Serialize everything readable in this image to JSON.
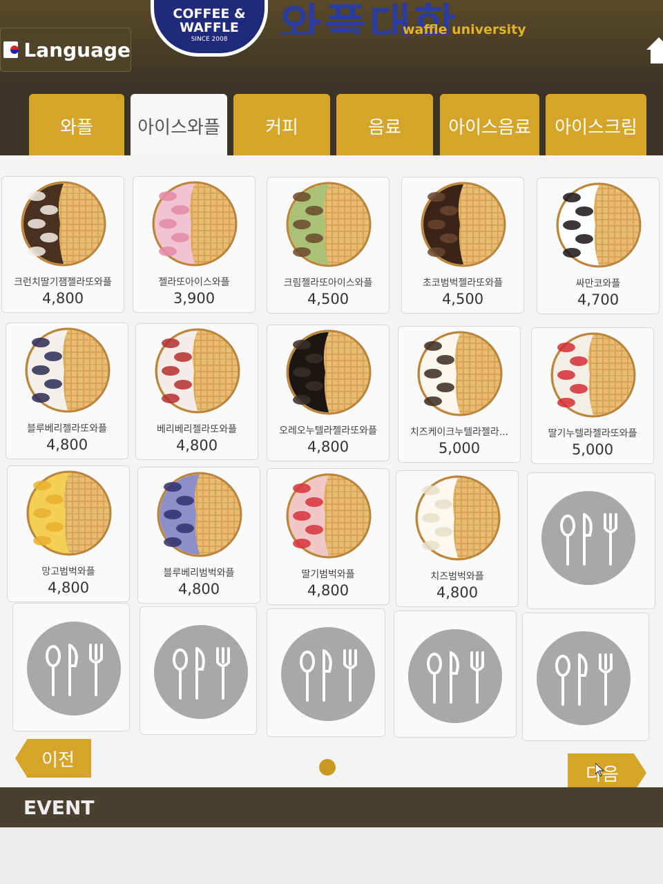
{
  "header": {
    "language_label": "Language",
    "logo_line1": "COFFEE &",
    "logo_line2": "WAFFLE",
    "logo_since": "SINCE 2008",
    "brand_name_kr": "와플대학",
    "brand_name_en": "waffle university"
  },
  "tabs": [
    {
      "label": "와플",
      "active": false
    },
    {
      "label": "아이스와플",
      "active": true
    },
    {
      "label": "커피",
      "active": false
    },
    {
      "label": "음료",
      "active": false
    },
    {
      "label": "아이스음료",
      "active": false
    },
    {
      "label": "아이스크림",
      "active": false
    }
  ],
  "menu": {
    "items": [
      {
        "name": "크런치딸기잼젤라또와플",
        "price": "4,800",
        "topping": "crunch"
      },
      {
        "name": "젤라또아이스와플",
        "price": "3,900",
        "topping": "pink"
      },
      {
        "name": "크림젤라또아이스와플",
        "price": "4,500",
        "topping": "green"
      },
      {
        "name": "초코범벅젤라또와플",
        "price": "4,500",
        "topping": "choco"
      },
      {
        "name": "싸만코와플",
        "price": "4,700",
        "topping": "cream-choco"
      },
      {
        "name": "블루베리젤라또와플",
        "price": "4,800",
        "topping": "blueberry"
      },
      {
        "name": "베리베리젤라또와플",
        "price": "4,800",
        "topping": "berry"
      },
      {
        "name": "오레오누텔라젤라또와플",
        "price": "4,800",
        "topping": "oreo"
      },
      {
        "name": "치즈케이크누텔라젤라...",
        "price": "5,000",
        "topping": "cheesecake"
      },
      {
        "name": "딸기누텔라젤라또와플",
        "price": "5,000",
        "topping": "strawberry"
      },
      {
        "name": "망고범벅와플",
        "price": "4,800",
        "topping": "mango"
      },
      {
        "name": "블루베리범벅와플",
        "price": "4,800",
        "topping": "blueberry-cream"
      },
      {
        "name": "딸기범벅와플",
        "price": "4,800",
        "topping": "strawberry-cream"
      },
      {
        "name": "치즈범벅와플",
        "price": "4,800",
        "topping": "cheese"
      }
    ],
    "empty_slots": 6
  },
  "pager": {
    "prev_label": "이전",
    "next_label": "다음",
    "current_page": 1
  },
  "event": {
    "label": "EVENT"
  },
  "colors": {
    "accent_gold": "#d5a52a",
    "header_brown": "#3b3325",
    "panel_bg": "#f4f4f4",
    "brand_blue": "#2b3b9e",
    "placeholder_gray": "#a8a8a8"
  }
}
